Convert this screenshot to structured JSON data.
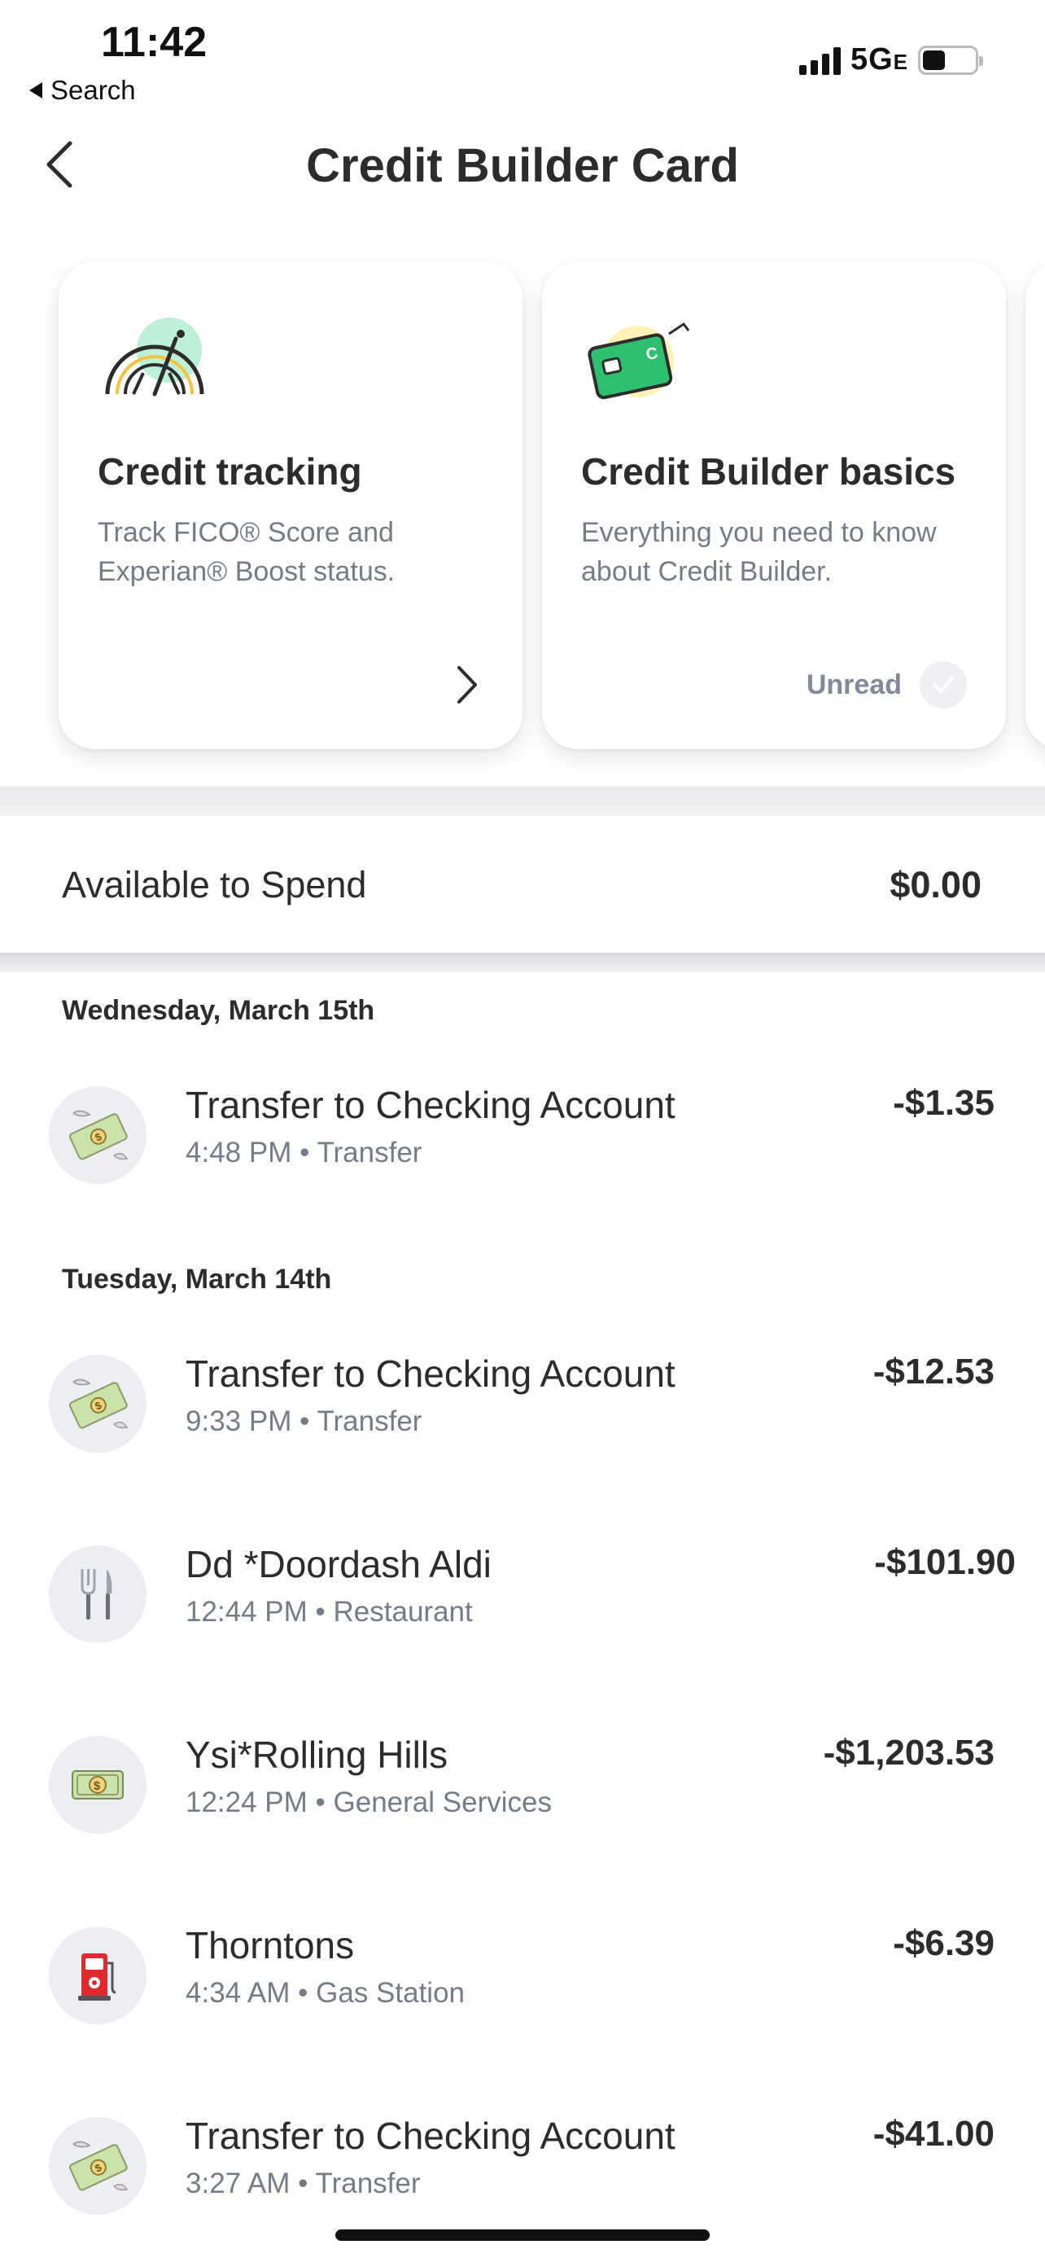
{
  "status_bar": {
    "time": "11:42",
    "back_label": "Search",
    "network": "5G",
    "network_suffix": "E",
    "battery_level": 0.44
  },
  "header": {
    "title": "Credit Builder Card",
    "back_icon": "chevron-left-icon"
  },
  "cards": [
    {
      "title": "Credit tracking",
      "description": "Track FICO® Score and Experian® Boost status.",
      "icon": "speedometer-icon",
      "action_icon": "chevron-right-icon"
    },
    {
      "title": "Credit Builder basics",
      "description": "Everything you need to know about Credit Builder.",
      "icon": "credit-card-icon",
      "status": "Unread",
      "status_icon": "check-icon"
    }
  ],
  "available": {
    "label": "Available to Spend",
    "amount": "$0.00"
  },
  "groups": [
    {
      "date": "Wednesday, March 15th",
      "transactions": [
        {
          "name": "Transfer to Checking Account",
          "time": "4:48 PM",
          "category": "Transfer",
          "amount": "-$1.35",
          "icon": "money-with-wings-icon"
        }
      ]
    },
    {
      "date": "Tuesday, March 14th",
      "transactions": [
        {
          "name": "Transfer to Checking Account",
          "time": "9:33 PM",
          "category": "Transfer",
          "amount": "-$12.53",
          "icon": "money-with-wings-icon"
        },
        {
          "name": "Dd *Doordash Aldi",
          "time": "12:44 PM",
          "category": "Restaurant",
          "amount": "-$101.90",
          "icon": "fork-knife-icon"
        },
        {
          "name": "Ysi*Rolling Hills",
          "time": "12:24 PM",
          "category": "General Services",
          "amount": "-$1,203.53",
          "icon": "dollar-banknote-icon"
        },
        {
          "name": "Thorntons",
          "time": "4:34 AM",
          "category": "Gas Station",
          "amount": "-$6.39",
          "icon": "fuel-pump-icon"
        },
        {
          "name": "Transfer to Checking Account",
          "time": "3:27 AM",
          "category": "Transfer",
          "amount": "-$41.00",
          "icon": "money-with-wings-icon"
        }
      ]
    }
  ],
  "colors": {
    "text_primary": "#2c2c2c",
    "text_secondary": "#777b88",
    "accent_green": "#2fbf71",
    "avatar_bg": "#eceef1"
  }
}
